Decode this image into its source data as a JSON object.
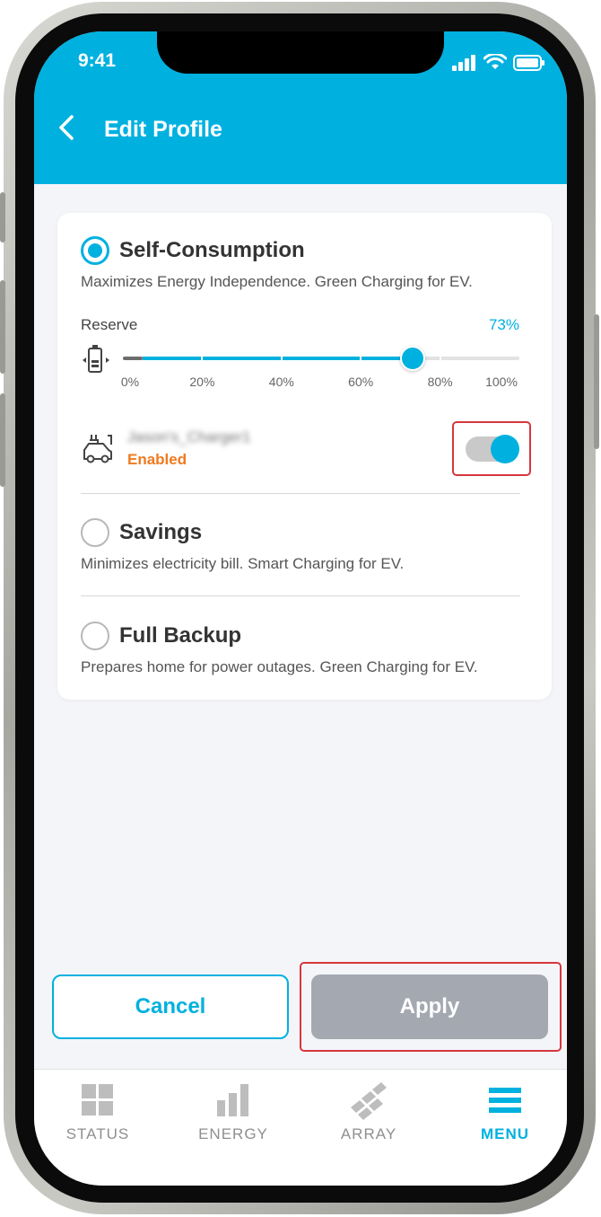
{
  "status_bar": {
    "time": "9:41"
  },
  "header": {
    "title": "Edit Profile"
  },
  "profiles": {
    "self_consumption": {
      "title": "Self-Consumption",
      "description": "Maximizes Energy Independence. Green Charging for EV.",
      "selected": true
    },
    "savings": {
      "title": "Savings",
      "description": "Minimizes electricity bill. Smart Charging for EV.",
      "selected": false
    },
    "full_backup": {
      "title": "Full Backup",
      "description": "Prepares home for power outages. Green Charging for EV.",
      "selected": false
    }
  },
  "reserve": {
    "label": "Reserve",
    "value_text": "73%",
    "value": 0.73,
    "ticks": [
      "0%",
      "20%",
      "40%",
      "60%",
      "80%",
      "100%"
    ]
  },
  "charger": {
    "name": "Jason's_Charger1",
    "status": "Enabled",
    "enabled": true
  },
  "buttons": {
    "cancel": "Cancel",
    "apply": "Apply"
  },
  "nav": {
    "items": [
      {
        "label": "STATUS",
        "icon": "status-grid-icon",
        "active": false
      },
      {
        "label": "ENERGY",
        "icon": "energy-bars-icon",
        "active": false
      },
      {
        "label": "ARRAY",
        "icon": "array-panels-icon",
        "active": false
      },
      {
        "label": "MENU",
        "icon": "menu-icon",
        "active": true
      }
    ]
  },
  "colors": {
    "accent": "#00b1df",
    "enabled": "#f07a1f",
    "highlight": "#d6373e",
    "apply_disabled": "#a4a9b1"
  }
}
